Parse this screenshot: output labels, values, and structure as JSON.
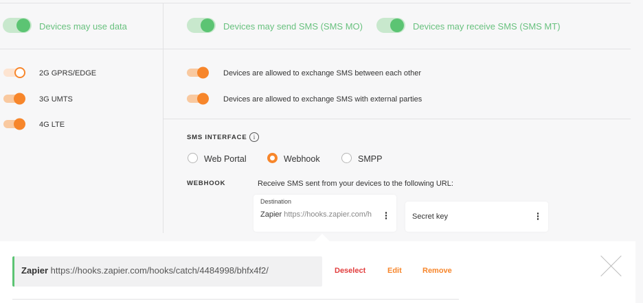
{
  "data_toggles": {
    "use_data": {
      "label": "Devices may use data",
      "on": true
    },
    "send_sms": {
      "label": "Devices may send SMS (SMS MO)",
      "on": true
    },
    "receive_sms": {
      "label": "Devices may receive SMS (SMS MT)",
      "on": true
    }
  },
  "networks": [
    {
      "label": "2G GPRS/EDGE",
      "on": false
    },
    {
      "label": "3G UMTS",
      "on": true
    },
    {
      "label": "4G LTE",
      "on": true
    }
  ],
  "sms_options": [
    {
      "label": "Devices are allowed to exchange SMS between each other",
      "on": true
    },
    {
      "label": "Devices are allowed to exchange SMS with external parties",
      "on": true
    }
  ],
  "sms_interface": {
    "title": "SMS INTERFACE",
    "info_icon": "i",
    "options": [
      "Web Portal",
      "Webhook",
      "SMPP"
    ],
    "selected": "Webhook"
  },
  "webhook": {
    "title": "WEBHOOK",
    "description": "Receive SMS sent from your devices to the following URL:",
    "destination_label": "Destination",
    "destination_name": "Zapier",
    "destination_url": "https://hooks.zapier.com/h",
    "secret_label": "Secret key"
  },
  "dropdown": {
    "name": "Zapier",
    "url": "https://hooks.zapier.com/hooks/catch/4484998/bhfx4f2/",
    "deselect": "Deselect",
    "edit": "Edit",
    "remove": "Remove"
  },
  "colors": {
    "green": "#5cc473",
    "orange": "#f7862b",
    "deselect_red": "#e23d3d"
  }
}
